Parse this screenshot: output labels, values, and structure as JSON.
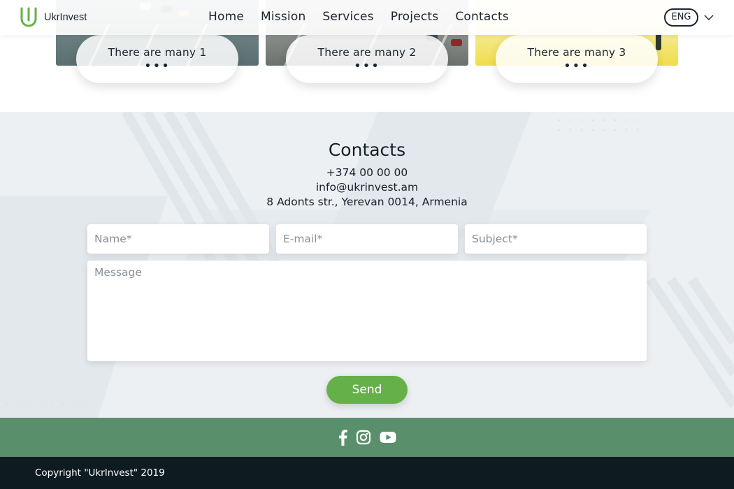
{
  "header": {
    "brand": "UkrInvest",
    "nav": [
      {
        "label": "Home"
      },
      {
        "label": "Mission"
      },
      {
        "label": "Services"
      },
      {
        "label": "Projects"
      },
      {
        "label": "Contacts"
      }
    ],
    "language": "ENG",
    "icons": {
      "logo": "ukrinvest-logo-icon",
      "language_dropdown": "chevron-down-icon"
    }
  },
  "projects": {
    "cards": [
      {
        "title": "There are many 1",
        "more": "•••"
      },
      {
        "title": "There are many 2",
        "more": "•••"
      },
      {
        "title": "There are many 3",
        "more": "•••"
      }
    ]
  },
  "contacts": {
    "title": "Contacts",
    "phone": "+374 00 00 00",
    "email": "info@ukrinvest.am",
    "address": "8 Adonts str., Yerevan 0014, Armenia",
    "form": {
      "name_placeholder": "Name*",
      "email_placeholder": "E-mail*",
      "subject_placeholder": "Subject*",
      "message_placeholder": "Message",
      "send_label": "Send"
    }
  },
  "social": {
    "icons": [
      "facebook-icon",
      "instagram-icon",
      "youtube-icon"
    ]
  },
  "footer": {
    "copyright": "Copyright \"UkrInvest\" 2019"
  },
  "colors": {
    "brand_green": "#66b04a",
    "social_bar": "#5a8f6c",
    "footer_bg": "#0e1c22",
    "section_bg": "#edf0f3"
  }
}
